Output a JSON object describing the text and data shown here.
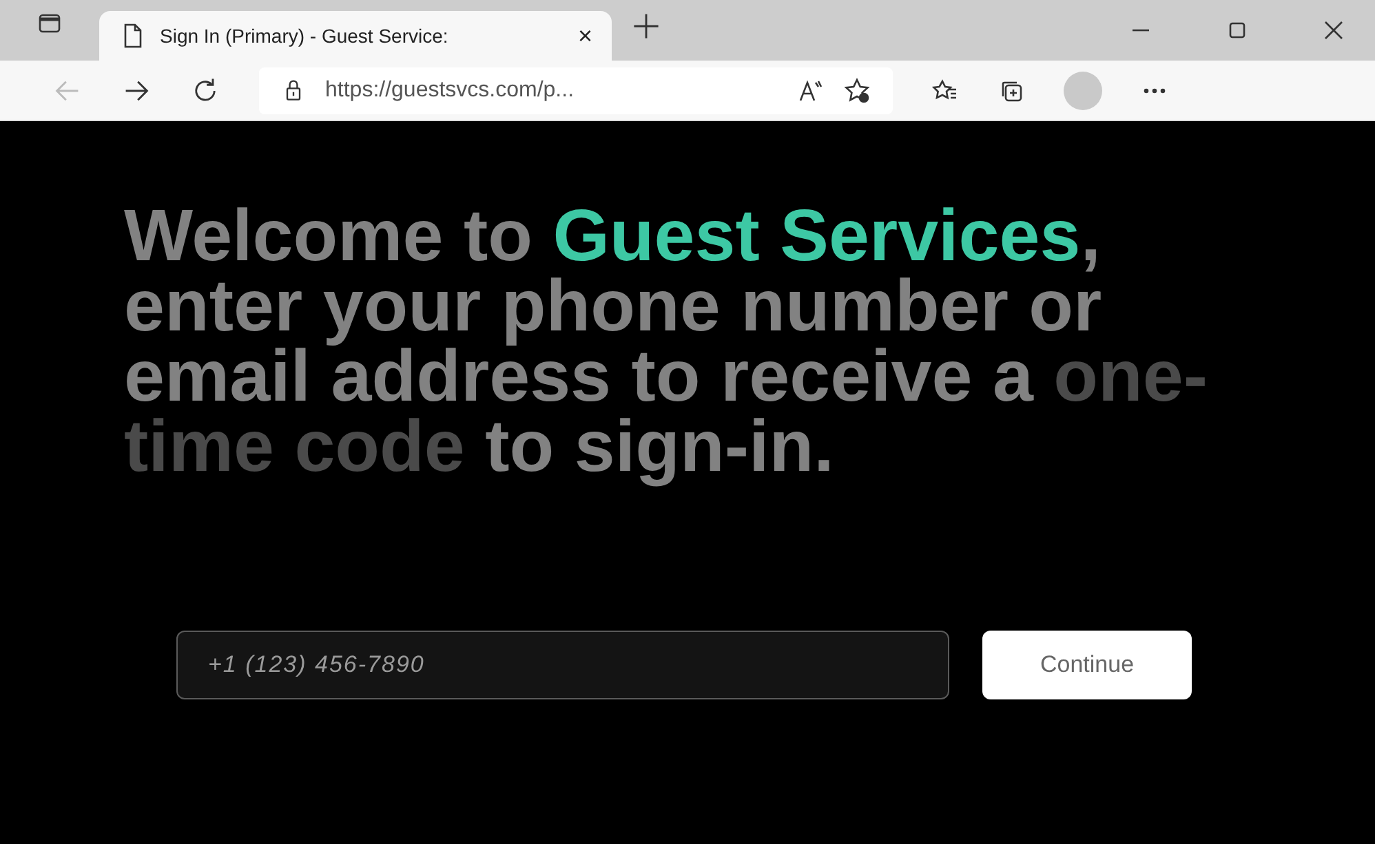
{
  "browser": {
    "tab": {
      "title": "Sign In (Primary) - Guest Service:",
      "selected": true,
      "close": "×"
    },
    "address": "https://guestsvcs.com/p..."
  },
  "heading": {
    "segments": [
      {
        "kind": "normal",
        "text": "Welcome to "
      },
      {
        "kind": "brand",
        "text": "Guest Services"
      },
      {
        "kind": "normal",
        "text": ", enter your phone number or email address to receive a "
      },
      {
        "kind": "dim",
        "text": "one-time code"
      },
      {
        "kind": "normal",
        "text": " to sign-in."
      }
    ]
  },
  "form": {
    "placeholder": "+1 (123) 456-7890",
    "button": "Continue"
  }
}
